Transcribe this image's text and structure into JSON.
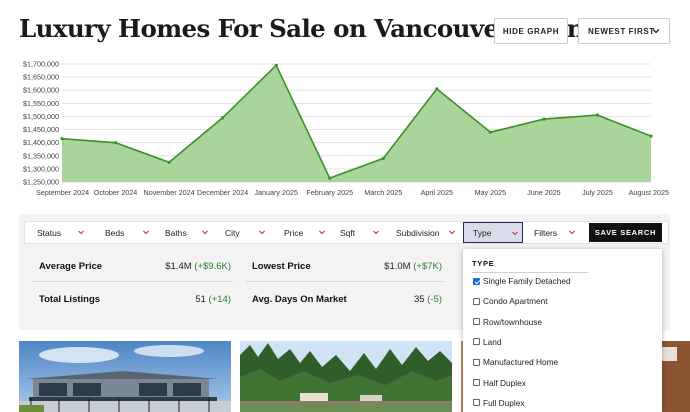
{
  "header": {
    "title": "Luxury Homes For Sale on Vancouver Island",
    "hide_graph_label": "HIDE GRAPH",
    "sort_label": "NEWEST FIRST"
  },
  "chart_data": {
    "type": "area",
    "x": [
      "September 2024",
      "October 2024",
      "November 2024",
      "December 2024",
      "January 2025",
      "February 2025",
      "March 2025",
      "April 2025",
      "May 2025",
      "June 2025",
      "July 2025",
      "August 2025"
    ],
    "values": [
      1415000,
      1400000,
      1325000,
      1495000,
      1695000,
      1265000,
      1340000,
      1605000,
      1440000,
      1490000,
      1505000,
      1425000
    ],
    "ylim": [
      1250000,
      1700000
    ],
    "yticks": [
      "$1,700,000",
      "$1,650,000",
      "$1,600,000",
      "$1,550,000",
      "$1,500,000",
      "$1,450,000",
      "$1,400,000",
      "$1,350,000",
      "$1,300,000",
      "$1,250,000"
    ],
    "grid": true,
    "colors": {
      "line": "#3d8f2b",
      "fill": "#a9d49a"
    }
  },
  "filters": [
    {
      "key": "status",
      "label": "Status"
    },
    {
      "key": "beds",
      "label": "Beds"
    },
    {
      "key": "baths",
      "label": "Baths"
    },
    {
      "key": "city",
      "label": "City"
    },
    {
      "key": "price",
      "label": "Price"
    },
    {
      "key": "sqft",
      "label": "Sqft"
    },
    {
      "key": "subdivision",
      "label": "Subdivision"
    },
    {
      "key": "type",
      "label": "Type",
      "active": true
    },
    {
      "key": "filters",
      "label": "Filters"
    }
  ],
  "save_search_label": "SAVE SEARCH",
  "stats": {
    "average_price": {
      "label": "Average Price",
      "value": "$1.4M",
      "change": "(+$9.6K)"
    },
    "lowest_price": {
      "label": "Lowest Price",
      "value": "$1.0M",
      "change": "(+$7K)"
    },
    "total_listings": {
      "label": "Total Listings",
      "value": "51",
      "change": "(+14)"
    },
    "avg_days": {
      "label": "Avg. Days On Market",
      "value": "35",
      "change": "(-5)"
    }
  },
  "type_dropdown": {
    "title": "TYPE",
    "options": [
      {
        "label": "Single Family Detached",
        "checked": true
      },
      {
        "label": "Condo Apartment",
        "checked": false
      },
      {
        "label": "Row/townhouse",
        "checked": false
      },
      {
        "label": "Land",
        "checked": false
      },
      {
        "label": "Manufactured Home",
        "checked": false
      },
      {
        "label": "Half Duplex",
        "checked": false
      },
      {
        "label": "Full Duplex",
        "checked": false
      }
    ]
  },
  "listings": [
    {
      "image": "modern-house-photo"
    },
    {
      "image": "forest-property-photo"
    },
    {
      "image": "interior-photo"
    }
  ]
}
